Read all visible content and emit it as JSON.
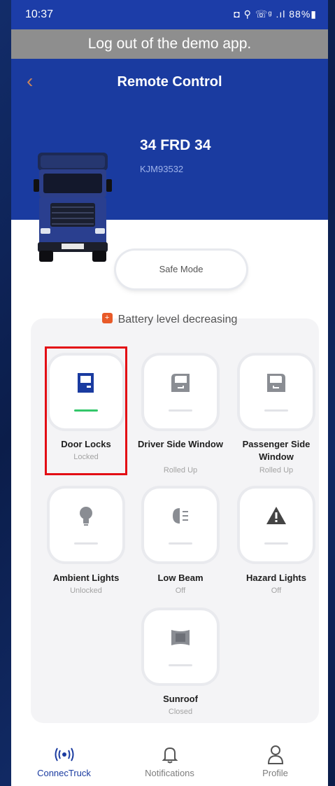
{
  "status_bar": {
    "time": "10:37",
    "indicators": "◘ ⚲ ☏ᵍ .ıl 88%▮"
  },
  "banner": {
    "text": "Log out of the demo app."
  },
  "header": {
    "back_icon": "chevron-left-icon",
    "title": "Remote Control"
  },
  "vehicle": {
    "plate": "34 FRD 34",
    "vin": "KJM93532"
  },
  "safe_mode": {
    "label": "Safe Mode"
  },
  "battery_warning": {
    "badge": "+",
    "text": "Battery level decreasing"
  },
  "controls": [
    {
      "label": "Door Locks",
      "status": "Locked",
      "icon": "door-lock-icon",
      "active": true
    },
    {
      "label": "Driver Side Window",
      "status": "Rolled Up",
      "icon": "driver-window-icon",
      "active": false
    },
    {
      "label": "Passenger Side Window",
      "status": "Rolled Up",
      "icon": "passenger-window-icon",
      "active": false
    },
    {
      "label": "Ambient Lights",
      "status": "Unlocked",
      "icon": "bulb-icon",
      "active": false
    },
    {
      "label": "Low Beam",
      "status": "Off",
      "icon": "low-beam-icon",
      "active": false
    },
    {
      "label": "Hazard Lights",
      "status": "Off",
      "icon": "hazard-icon",
      "active": false
    },
    {
      "label": "Sunroof",
      "status": "Closed",
      "icon": "sunroof-icon",
      "active": false
    }
  ],
  "tabs": [
    {
      "label": "ConnecTruck",
      "icon": "signal-icon",
      "selected": true
    },
    {
      "label": "Notifications",
      "icon": "bell-icon",
      "selected": false
    },
    {
      "label": "Profile",
      "icon": "user-icon",
      "selected": false
    }
  ],
  "colors": {
    "brand_blue": "#1a3ba0",
    "active_green": "#33c76a",
    "highlight_red": "#e30e14",
    "warning_orange": "#e85a28"
  }
}
